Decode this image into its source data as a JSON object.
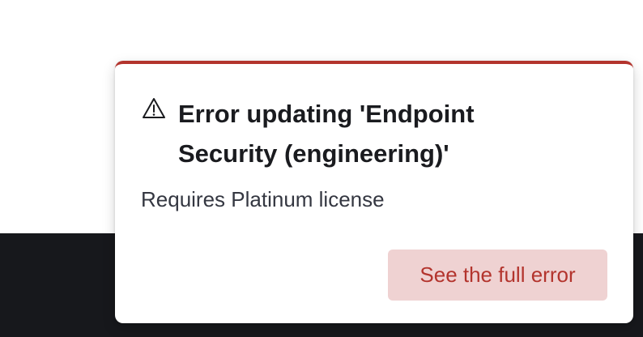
{
  "toast": {
    "title": "Error updating 'Endpoint Security (engineering)'",
    "message": "Requires Platinum license",
    "button_label": "See the full error",
    "icon": "warning-icon"
  },
  "colors": {
    "danger": "#b3342d",
    "danger_light": "#efd2d2",
    "dark_bar": "#17181c",
    "text": "#1a1b1f"
  }
}
